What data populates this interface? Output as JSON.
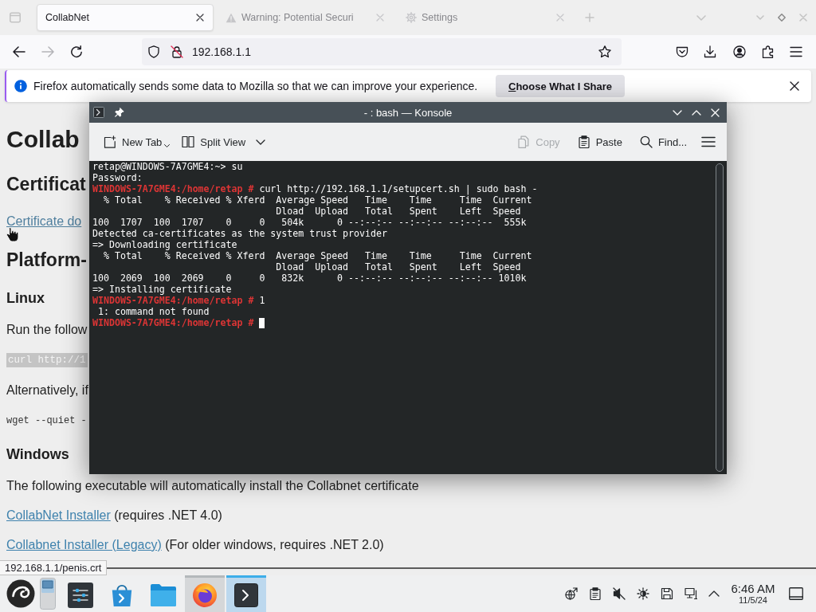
{
  "browser": {
    "tabs": [
      {
        "kind": "page",
        "title": "CollabNet",
        "selected": true
      },
      {
        "kind": "warning",
        "title": "Warning: Potential Securi",
        "selected": false
      },
      {
        "kind": "settings",
        "title": "Settings",
        "selected": false
      }
    ],
    "nav": [
      {
        "kind": "back",
        "disabled": false
      },
      {
        "kind": "forward",
        "disabled": true
      },
      {
        "kind": "reload",
        "disabled": false
      }
    ],
    "url": "192.168.1.1",
    "notification": {
      "message": "Firefox automatically sends some data to Mozilla so that we can improve your experience.",
      "button": "Choose What I Share"
    },
    "page": {
      "blocks": [
        {
          "kind": "h1",
          "text": "Collab"
        },
        {
          "kind": "h2",
          "text": "Certificat"
        },
        {
          "kind": "link",
          "text": "Certificate do"
        },
        {
          "kind": "h2",
          "text": "Platform-"
        },
        {
          "kind": "h3",
          "text": "Linux"
        },
        {
          "kind": "text",
          "text": "Run the follow"
        },
        {
          "kind": "code",
          "text": "curl http://1"
        },
        {
          "kind": "text",
          "text": "Alternatively, if"
        },
        {
          "kind": "pre",
          "text": "wget --quiet -"
        },
        {
          "kind": "h3",
          "text": "Windows"
        },
        {
          "kind": "text",
          "text": "The following executable will automatically install the Collabnet certificate"
        },
        {
          "kind": "link_text",
          "link": "CollabNet Installer",
          "text": "(requires .NET 4.0)"
        },
        {
          "kind": "link_text",
          "link": "Collabnet Installer (Legacy)",
          "text": "(For older windows, requires .NET 2.0)"
        }
      ]
    },
    "status_url": "192.168.1.1/penis.crt"
  },
  "terminal": {
    "title": "- : bash — Konsole",
    "toolbar_left": [
      {
        "kind": "new-tab",
        "label": "New Tab",
        "disabled": false
      },
      {
        "kind": "split-view",
        "label": "Split View",
        "disabled": false
      }
    ],
    "toolbar_right": [
      {
        "kind": "copy",
        "label": "Copy",
        "disabled": true
      },
      {
        "kind": "paste",
        "label": "Paste",
        "disabled": false
      },
      {
        "kind": "find",
        "label": "Find...",
        "disabled": false
      }
    ],
    "lines": [
      {
        "kind": "output",
        "text": "retap@WINDOWS-7A7GME4:~> su"
      },
      {
        "kind": "output",
        "text": "Password:"
      },
      {
        "kind": "prompt",
        "prompt": "WINDOWS-7A7GME4:/home/retap #",
        "command": "curl http://192.168.1.1/setupcert.sh | sudo bash -",
        "cursor": false
      },
      {
        "kind": "output",
        "text": "  % Total    % Received % Xferd  Average Speed   Time    Time     Time  Current"
      },
      {
        "kind": "output",
        "text": "                                 Dload  Upload   Total   Spent    Left  Speed"
      },
      {
        "kind": "output",
        "text": "100  1707  100  1707    0     0   504k      0 --:--:-- --:--:-- --:--:--  555k"
      },
      {
        "kind": "output",
        "text": "Detected ca-certificates as the system trust provider"
      },
      {
        "kind": "output",
        "text": "=> Downloading certificate"
      },
      {
        "kind": "output",
        "text": "  % Total    % Received % Xferd  Average Speed   Time    Time     Time  Current"
      },
      {
        "kind": "output",
        "text": "                                 Dload  Upload   Total   Spent    Left  Speed"
      },
      {
        "kind": "output",
        "text": "100  2069  100  2069    0     0   832k      0 --:--:-- --:--:-- --:--:-- 1010k"
      },
      {
        "kind": "output",
        "text": "=> Installing certificate"
      },
      {
        "kind": "prompt",
        "prompt": "WINDOWS-7A7GME4:/home/retap #",
        "command": "1",
        "cursor": false
      },
      {
        "kind": "output",
        "text": " 1: command not found"
      },
      {
        "kind": "prompt",
        "prompt": "WINDOWS-7A7GME4:/home/retap #",
        "cursor": true
      }
    ]
  },
  "taskbar": {
    "tasks": [
      {
        "kind": "settings",
        "running": false,
        "selected": false
      },
      {
        "kind": "store",
        "running": false,
        "selected": false
      },
      {
        "kind": "files",
        "running": false,
        "selected": false
      },
      {
        "kind": "browser",
        "running": true,
        "selected": false
      },
      {
        "kind": "terminal",
        "running": true,
        "selected": true
      }
    ],
    "tray": [
      {
        "kind": "updates"
      },
      {
        "kind": "clipboard"
      },
      {
        "kind": "volume",
        "muted": true
      },
      {
        "kind": "brightness"
      },
      {
        "kind": "disks"
      },
      {
        "kind": "network"
      },
      {
        "kind": "expand"
      }
    ],
    "clock": {
      "time": "6:46 AM",
      "date": "11/5/24"
    }
  }
}
